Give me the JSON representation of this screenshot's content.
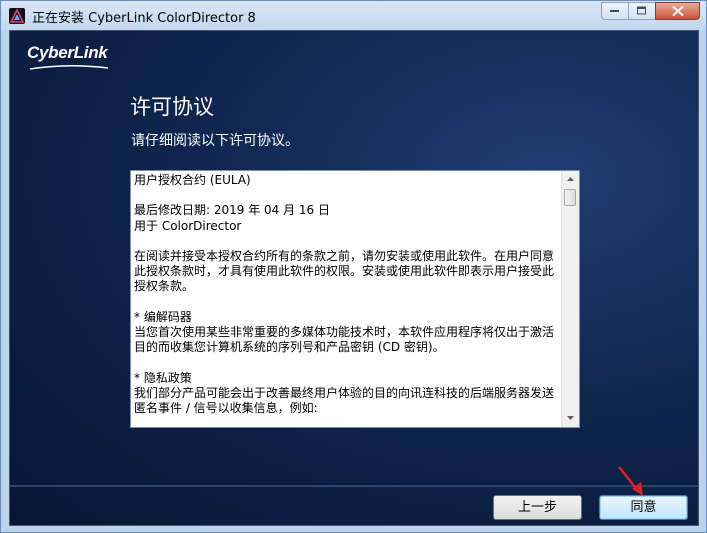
{
  "window": {
    "title": "正在安装 CyberLink ColorDirector 8"
  },
  "header": {
    "logo_text": "CyberLink",
    "title": "许可协议",
    "subtitle": "请仔细阅读以下许可协议。"
  },
  "license": {
    "paragraphs": [
      "用户授权合约 (EULA)",
      "最后修改日期: 2019 年 04 月 16 日\n用于 ColorDirector",
      "在阅读并接受本授权合约所有的条款之前，请勿安装或使用此软件。在用户同意此授权条款时，才具有使用此软件的权限。安装或使用此软件即表示用户接受此授权条款。",
      "* 编解码器\n当您首次使用某些非常重要的多媒体功能技术时，本软件应用程序将仅出于激活目的而收集您计算机系统的序列号和产品密钥 (CD 密钥)。",
      "* 隐私政策\n我们部分产品可能会出于改善最终用户体验的目的向讯连科技的后端服务器发送匿名事件 / 信号以收集信息，例如:"
    ]
  },
  "buttons": {
    "back": "上一步",
    "agree": "同意"
  },
  "colors": {
    "background_dark": "#10264f",
    "annotation_arrow": "#e02020"
  },
  "icons": {
    "app": "colordirector-icon",
    "minimize": "minimize-icon",
    "maximize": "maximize-icon",
    "close": "close-icon",
    "scroll_up": "scroll-up-icon",
    "scroll_down": "scroll-down-icon"
  }
}
